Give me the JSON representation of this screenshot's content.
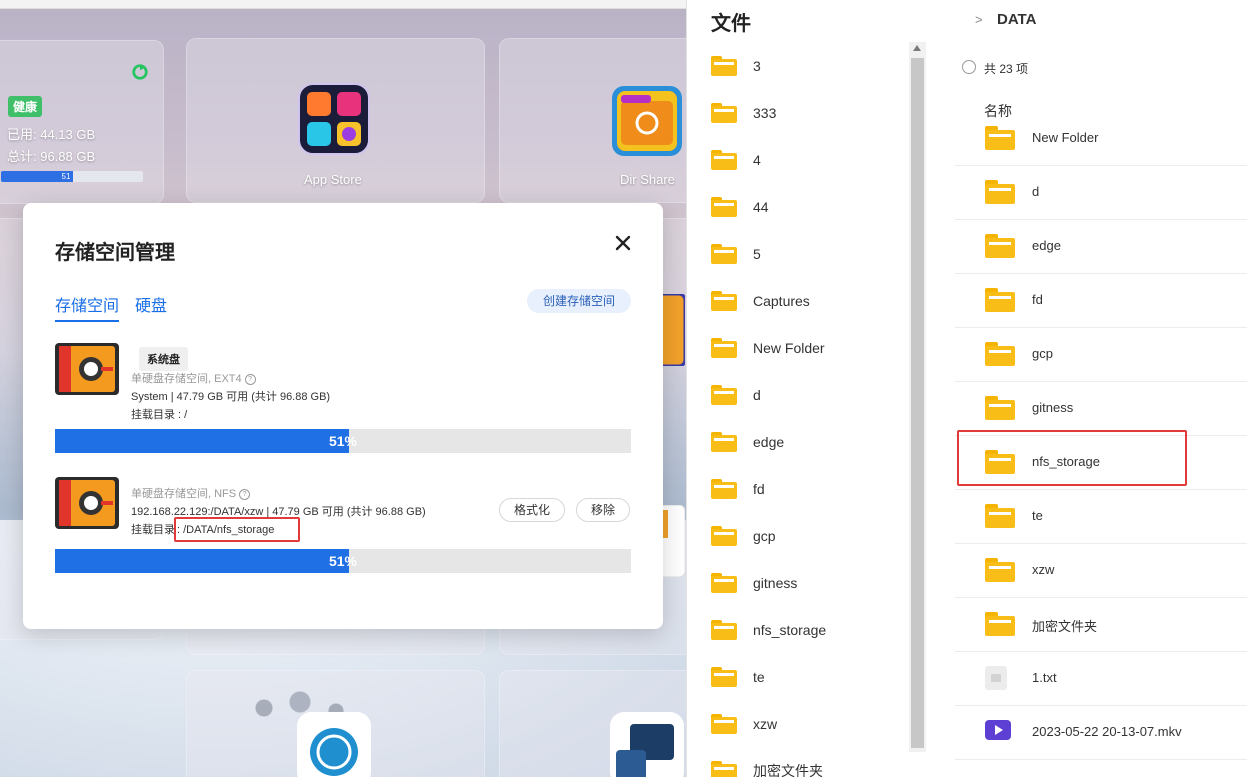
{
  "colors": {
    "accent": "#1a6fe8",
    "health": "#3fbf6a",
    "highlight": "#e03a3a",
    "folder": "#f8bd17"
  },
  "desktop": {
    "storage_widget": {
      "status_badge": "健康",
      "used": "已用: 44.13 GB",
      "total": "总计: 96.88 GB",
      "usage_percent": 51,
      "usage_label": "51"
    },
    "apps": [
      {
        "label": "App Store",
        "icon": "app-store-icon"
      },
      {
        "label": "Dir Share",
        "icon": "dir-share-icon"
      }
    ]
  },
  "modal": {
    "title": "存储空间管理",
    "tabs": [
      "存储空间",
      "硬盘"
    ],
    "create_button": "创建存储空间",
    "volumes": [
      {
        "tag": "系统盘",
        "type": "单硬盘存储空间, EXT4",
        "detail": "System | 47.79 GB 可用 (共计 96.88 GB)",
        "mount": "挂载目录 : /",
        "usage_percent": 51,
        "usage_label": "51%"
      },
      {
        "type": "单硬盘存储空间, NFS",
        "detail": "192.168.22.129:/DATA/xzw | 47.79 GB 可用 (共计 96.88 GB)",
        "mount_label": "挂载目录",
        "mount_path": ": /DATA/nfs_storage",
        "format_button": "格式化",
        "remove_button": "移除",
        "usage_percent": 51,
        "usage_label": "51%"
      }
    ]
  },
  "files_panel": {
    "title": "文件",
    "items": [
      "3",
      "333",
      "4",
      "44",
      "5",
      "Captures",
      "New Folder",
      "d",
      "edge",
      "fd",
      "gcp",
      "gitness",
      "nfs_storage",
      "te",
      "xzw",
      "加密文件夹"
    ]
  },
  "data_panel": {
    "breadcrumb": "DATA",
    "count": "共 23 项",
    "column_name": "名称",
    "items": [
      {
        "name": "New Folder",
        "type": "folder"
      },
      {
        "name": "d",
        "type": "folder"
      },
      {
        "name": "edge",
        "type": "folder"
      },
      {
        "name": "fd",
        "type": "folder"
      },
      {
        "name": "gcp",
        "type": "folder"
      },
      {
        "name": "gitness",
        "type": "folder"
      },
      {
        "name": "nfs_storage",
        "type": "folder"
      },
      {
        "name": "te",
        "type": "folder"
      },
      {
        "name": "xzw",
        "type": "folder"
      },
      {
        "name": "加密文件夹",
        "type": "folder"
      },
      {
        "name": "1.txt",
        "type": "text"
      },
      {
        "name": "2023-05-22 20-13-07.mkv",
        "type": "video"
      }
    ]
  }
}
